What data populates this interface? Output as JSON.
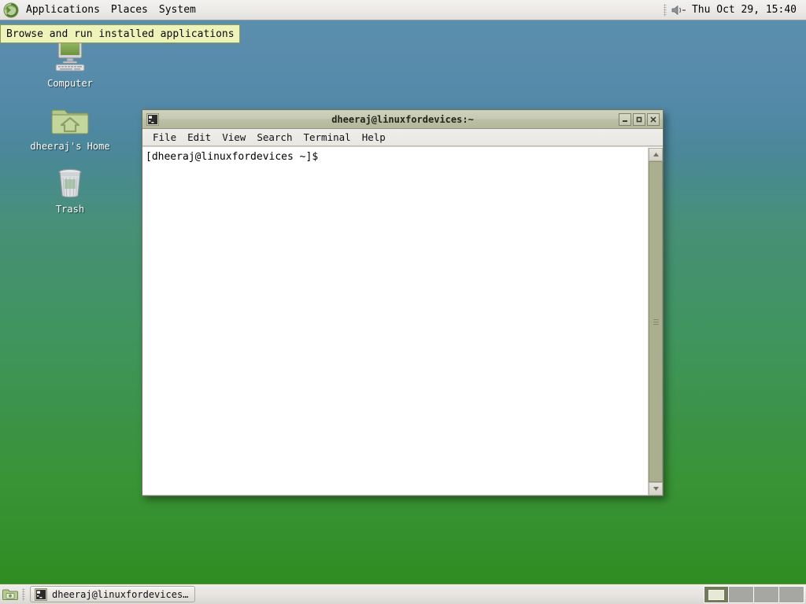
{
  "top_panel": {
    "logo_icon": "gnome-foot-icon",
    "menus": [
      {
        "label": "Applications",
        "name": "menu-applications"
      },
      {
        "label": "Places",
        "name": "menu-places"
      },
      {
        "label": "System",
        "name": "menu-system"
      }
    ],
    "volume_icon": "volume-speaker-icon",
    "clock": "Thu Oct 29, 15:40"
  },
  "tooltip": {
    "text": "Browse and run installed applications"
  },
  "desktop_icons": [
    {
      "label": "Computer",
      "icon": "computer-icon"
    },
    {
      "label": "dheeraj's Home",
      "icon": "home-folder-icon"
    },
    {
      "label": "Trash",
      "icon": "trash-icon"
    }
  ],
  "terminal": {
    "title": "dheeraj@linuxfordevices:~",
    "title_icon": "terminal-icon",
    "window_buttons": {
      "minimize": "minimize-icon",
      "maximize": "maximize-icon",
      "close": "close-icon"
    },
    "menu_items": [
      {
        "label": "File"
      },
      {
        "label": "Edit"
      },
      {
        "label": "View"
      },
      {
        "label": "Search"
      },
      {
        "label": "Terminal"
      },
      {
        "label": "Help"
      }
    ],
    "prompt": "[dheeraj@linuxfordevices ~]$ ",
    "scrollbar": {
      "up_icon": "scroll-up-arrow-icon",
      "down_icon": "scroll-down-arrow-icon"
    }
  },
  "bottom_panel": {
    "show_desktop_icon": "show-desktop-icon",
    "task_button": {
      "label": "dheeraj@linuxfordevices…",
      "icon": "terminal-icon"
    },
    "workspaces": [
      {
        "name": "workspace-1",
        "active": true
      },
      {
        "name": "workspace-2",
        "active": false
      },
      {
        "name": "workspace-3",
        "active": false
      },
      {
        "name": "workspace-4",
        "active": false
      }
    ]
  },
  "colors": {
    "desktop_top": "#5b8fae",
    "desktop_bottom": "#2f8c22",
    "panel_bg": "#ecebe7",
    "tooltip_bg": "#edf3b9",
    "titlebar_bg": "#c3c7b0",
    "scrollbar_thumb": "#aab08f",
    "workspace_active": "#717a5a"
  }
}
